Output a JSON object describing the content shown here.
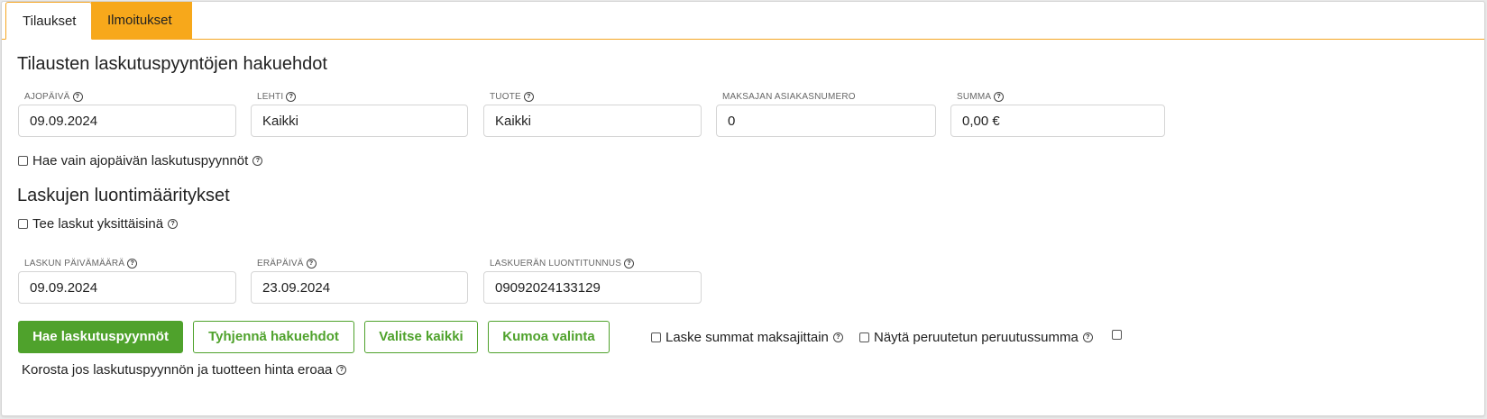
{
  "tabs": [
    {
      "label": "Tilaukset",
      "active": true
    },
    {
      "label": "Ilmoitukset",
      "active": false
    }
  ],
  "search_section": {
    "title": "Tilausten laskutuspyyntöjen hakuehdot",
    "fields": {
      "ajopaiva": {
        "label": "AJOPÄIVÄ",
        "value": "09.09.2024"
      },
      "lehti": {
        "label": "LEHTI",
        "value": "Kaikki"
      },
      "tuote": {
        "label": "TUOTE",
        "value": "Kaikki"
      },
      "maksaja": {
        "label": "MAKSAJAN ASIAKASNUMERO",
        "value": "0"
      },
      "summa": {
        "label": "SUMMA",
        "value": "0,00 €"
      }
    },
    "only_run_date_label": "Hae vain ajopäivän laskutuspyynnöt"
  },
  "invoice_section": {
    "title": "Laskujen luontimääritykset",
    "individual_label": "Tee laskut yksittäisinä",
    "fields": {
      "laskun_pvm": {
        "label": "LASKUN PÄIVÄMÄÄRÄ",
        "value": "09.09.2024"
      },
      "erapaiva": {
        "label": "ERÄPÄIVÄ",
        "value": "23.09.2024"
      },
      "luontitunnus": {
        "label": "LASKUERÄN LUONTITUNNUS",
        "value": "09092024133129"
      }
    }
  },
  "actions": {
    "fetch": "Hae laskutuspyynnöt",
    "clear": "Tyhjennä hakuehdot",
    "select_all": "Valitse kaikki",
    "deselect": "Kumoa valinta",
    "sum_by_payer": "Laske summat maksajittain",
    "show_cancelled": "Näytä peruutetun peruutussumma",
    "highlight_diff": "Korosta jos laskutuspyynnön ja tuotteen hinta eroaa"
  },
  "colors": {
    "accent": "#4fa22c",
    "tab_orange": "#f7a81b"
  }
}
